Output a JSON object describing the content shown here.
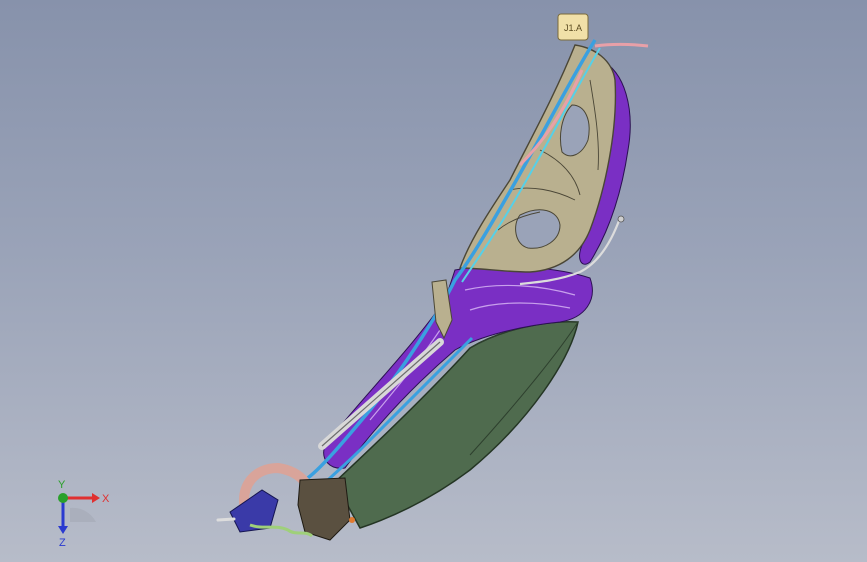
{
  "viewport": {
    "background_top": "#8792ab",
    "background_bottom": "#b7bcc9"
  },
  "model": {
    "tag_text": "J1.A",
    "colors": {
      "frame_beige": "#b9b08f",
      "frame_outline": "#4a4636",
      "foam_purple": "#7a2fc4",
      "cushion_green": "#4f6b4e",
      "rail_blue": "#3aa0e0",
      "rail_cyan": "#56d0e8",
      "pink_trim": "#e8a0a8",
      "tag_yellow": "#f1e0a8",
      "duct_pink": "#d9a49a",
      "bracket_blue": "#3a3aa8"
    }
  },
  "triad": {
    "x_label": "X",
    "y_label": "Y",
    "z_label": "Z",
    "x_color": "#e03030",
    "y_color": "#2aa02a",
    "z_color": "#2a3ad0"
  }
}
